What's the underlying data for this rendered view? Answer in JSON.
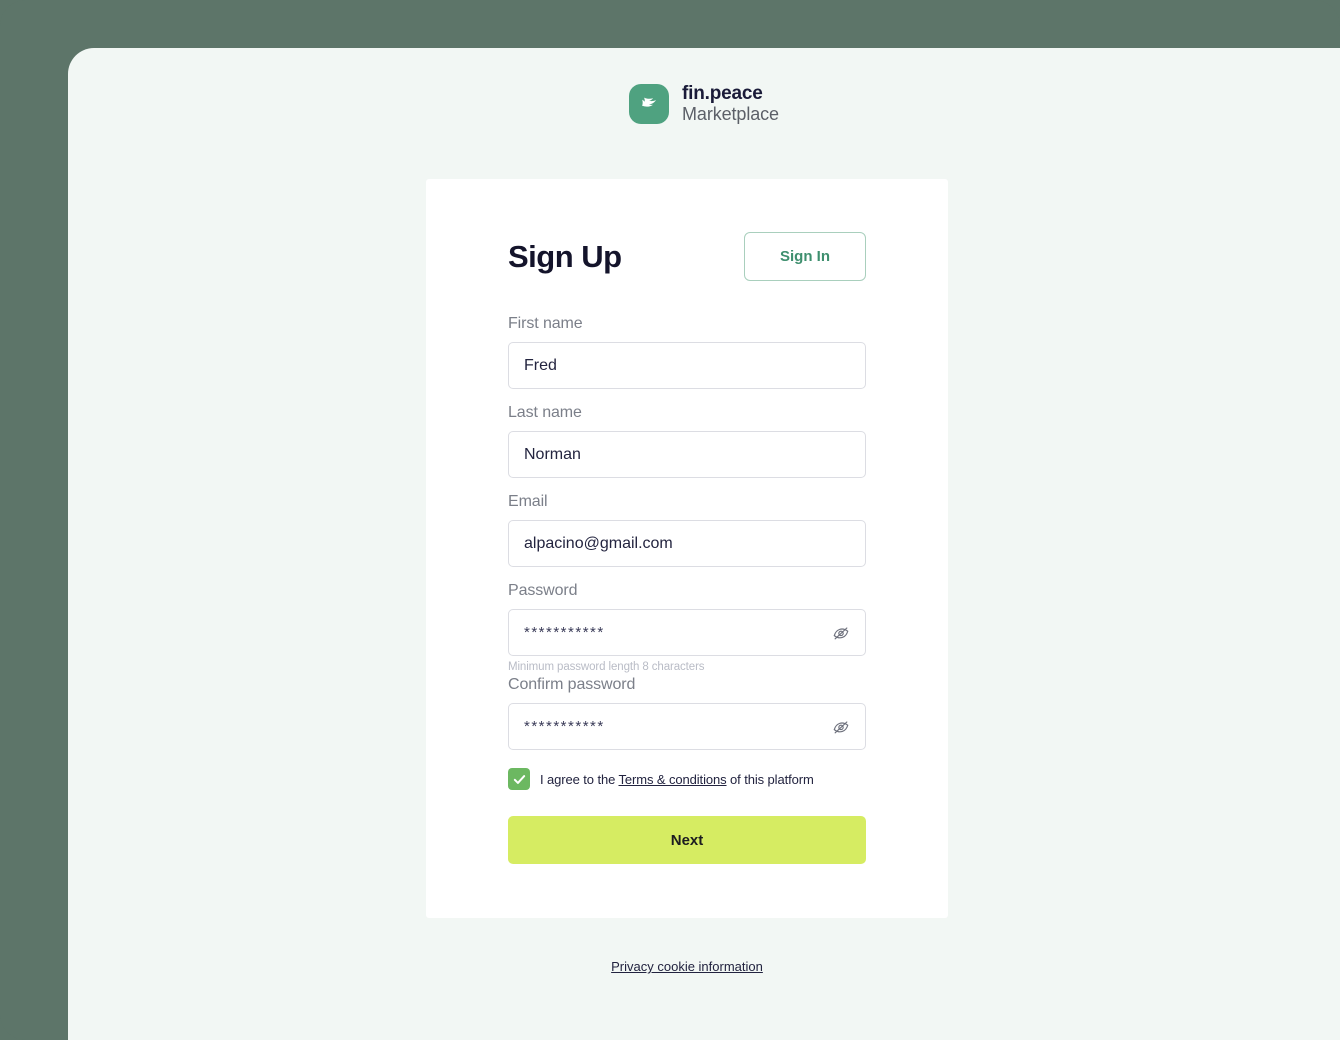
{
  "brand": {
    "logo_icon": "bird-swoosh-icon",
    "name": "fin.peace",
    "subtitle": "Marketplace",
    "mark_color": "#4fa280"
  },
  "card": {
    "title": "Sign Up",
    "signin_label": "Sign In",
    "fields": {
      "first_name": {
        "label": "First name",
        "value": "Fred",
        "placeholder": "First name"
      },
      "last_name": {
        "label": "Last name",
        "value": "Norman",
        "placeholder": "Last name"
      },
      "email": {
        "label": "Email",
        "value": "alpacino@gmail.com",
        "placeholder": "Email"
      },
      "password": {
        "label": "Password",
        "value": "***********",
        "placeholder": "Password",
        "hint": "Minimum password length 8 characters",
        "toggle_icon": "eye-off-icon"
      },
      "confirm_password": {
        "label": "Confirm password",
        "value": "***********",
        "placeholder": "Confirm password",
        "toggle_icon": "eye-off-icon"
      }
    },
    "terms": {
      "checked": true,
      "check_icon": "checkmark-icon",
      "prefix": "I agree to the ",
      "link": "Terms & conditions",
      "suffix": " of this platform",
      "checkbox_color": "#6cb861"
    },
    "submit_label": "Next",
    "submit_color": "#d6ec62"
  },
  "footer": {
    "privacy_link": "Privacy cookie information"
  },
  "theme": {
    "backdrop": "#5d7569",
    "panel": "#f2f7f4",
    "card": "#ffffff",
    "accent_green": "#3e8f6e",
    "text_dark": "#14142b"
  }
}
